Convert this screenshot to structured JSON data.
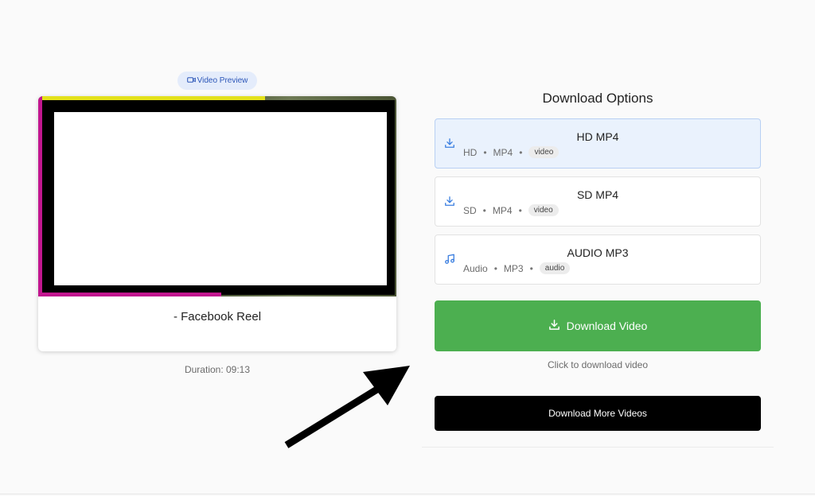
{
  "preview": {
    "badge_label": "Video Preview",
    "badge_icon": "video-camera-icon",
    "title": "- Facebook Reel",
    "duration": "Duration: 09:13"
  },
  "download": {
    "heading": "Download Options",
    "options": [
      {
        "label": "HD MP4",
        "quality": "HD",
        "format": "MP4",
        "type": "video",
        "icon": "download-icon",
        "selected": true
      },
      {
        "label": "SD MP4",
        "quality": "SD",
        "format": "MP4",
        "type": "video",
        "icon": "download-icon",
        "selected": false
      },
      {
        "label": "AUDIO MP3",
        "quality": "Audio",
        "format": "MP3",
        "type": "audio",
        "icon": "music-note-icon",
        "selected": false
      }
    ],
    "separator": "•",
    "primary_button": "Download Video",
    "primary_color": "#4caf50",
    "hint": "Click to download video",
    "more_button": "Download More Videos"
  },
  "annotation": {
    "arrow_icon": "arrow-pointer-icon"
  },
  "colors": {
    "accent_blue": "#3b7fe0",
    "selected_bg": "#eaf2fd"
  }
}
